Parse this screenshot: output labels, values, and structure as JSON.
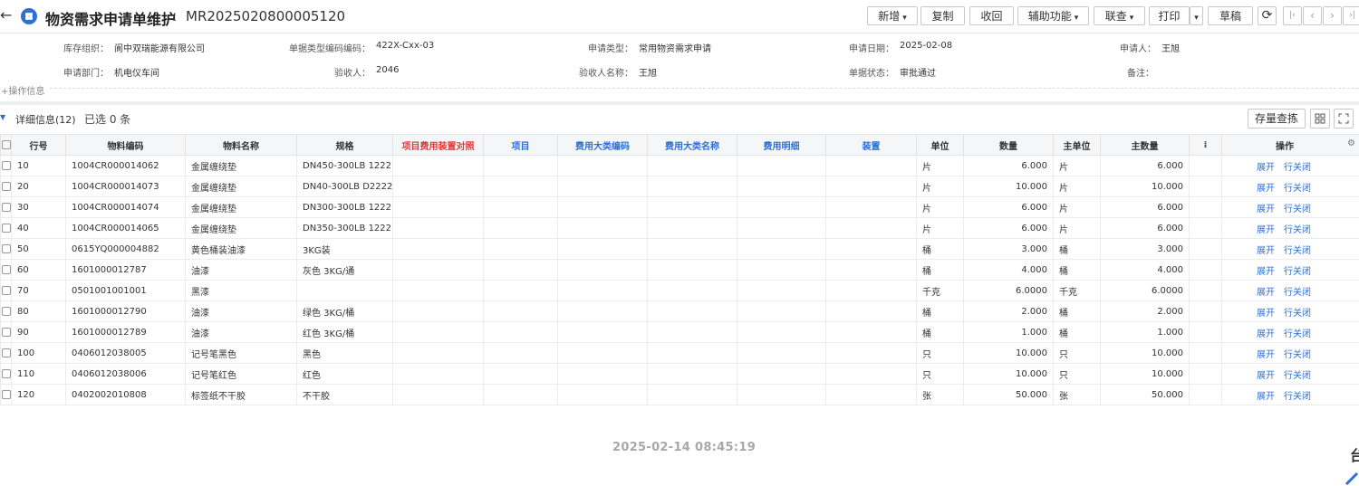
{
  "header": {
    "title": "物资需求申请单维护",
    "separator": ":",
    "code": "MR2025020800005120",
    "buttons": {
      "add": "新增",
      "copy": "复制",
      "recall": "收回",
      "aux": "辅助功能",
      "query": "联查",
      "print": "打印",
      "draft": "草稿"
    },
    "back_glyph": "←",
    "refresh_glyph": "⟳",
    "pager": [
      "|‹",
      "‹",
      "›",
      "›|"
    ]
  },
  "form": {
    "org_label": "库存组织：",
    "org_value": "阆中双瑞能源有限公司",
    "doctype_label": "单据类型编码编码：",
    "doctype_value": "422X-Cxx-03",
    "applytype_label": "申请类型：",
    "applytype_value": "常用物资需求申请",
    "date_label": "申请日期：",
    "date_value": "2025-02-08",
    "applicant_label": "申请人：",
    "applicant_value": "王旭",
    "dept_label": "申请部门：",
    "dept_value": "机电仪车间",
    "checker_label": "验收人：",
    "checker_value": "2046",
    "checkername_label": "验收人名称：",
    "checkername_value": "王旭",
    "status_label": "单据状态：",
    "status_value": "审批通过",
    "remark_label": "备注：",
    "remark_value": ""
  },
  "ops_toggle": "+操作信息",
  "detail": {
    "title": "详细信息(12)",
    "selected": "已选 0 条",
    "stock_button": "存量查拣"
  },
  "table": {
    "headers": [
      "行号",
      "物料编码",
      "物料名称",
      "规格",
      "项目费用装置对照",
      "项目",
      "费用大类编码",
      "费用大类名称",
      "费用明细",
      "装置",
      "单位",
      "数量",
      "主单位",
      "主数量",
      "",
      "操作"
    ],
    "rows": [
      {
        "no": "10",
        "code": "1004CR000014062",
        "name": "金属缠绕垫",
        "spec": "DN450-300LB 1222",
        "unit": "片",
        "qty": "6.000",
        "munit": "片",
        "mqty": "6.000"
      },
      {
        "no": "20",
        "code": "1004CR000014073",
        "name": "金属缠绕垫",
        "spec": "DN40-300LB D2222",
        "unit": "片",
        "qty": "10.000",
        "munit": "片",
        "mqty": "10.000"
      },
      {
        "no": "30",
        "code": "1004CR000014074",
        "name": "金属缠绕垫",
        "spec": "DN300-300LB 1222",
        "unit": "片",
        "qty": "6.000",
        "munit": "片",
        "mqty": "6.000"
      },
      {
        "no": "40",
        "code": "1004CR000014065",
        "name": "金属缠绕垫",
        "spec": "DN350-300LB 1222",
        "unit": "片",
        "qty": "6.000",
        "munit": "片",
        "mqty": "6.000"
      },
      {
        "no": "50",
        "code": "0615YQ000004882",
        "name": "黄色桶装油漆",
        "spec": "3KG装",
        "unit": "桶",
        "qty": "3.000",
        "munit": "桶",
        "mqty": "3.000"
      },
      {
        "no": "60",
        "code": "1601000012787",
        "name": "油漆",
        "spec": "灰色 3KG/通",
        "unit": "桶",
        "qty": "4.000",
        "munit": "桶",
        "mqty": "4.000"
      },
      {
        "no": "70",
        "code": "0501001001001",
        "name": "黑漆",
        "spec": "",
        "unit": "千克",
        "qty": "6.0000",
        "munit": "千克",
        "mqty": "6.0000"
      },
      {
        "no": "80",
        "code": "1601000012790",
        "name": "油漆",
        "spec": "绿色 3KG/桶",
        "unit": "桶",
        "qty": "2.000",
        "munit": "桶",
        "mqty": "2.000"
      },
      {
        "no": "90",
        "code": "1601000012789",
        "name": "油漆",
        "spec": "红色 3KG/桶",
        "unit": "桶",
        "qty": "1.000",
        "munit": "桶",
        "mqty": "1.000"
      },
      {
        "no": "100",
        "code": "0406012038005",
        "name": "记号笔黑色",
        "spec": "黑色",
        "unit": "只",
        "qty": "10.000",
        "munit": "只",
        "mqty": "10.000"
      },
      {
        "no": "110",
        "code": "0406012038006",
        "name": "记号笔红色",
        "spec": "红色",
        "unit": "只",
        "qty": "10.000",
        "munit": "只",
        "mqty": "10.000"
      },
      {
        "no": "120",
        "code": "0402002010808",
        "name": "标签纸不干胶",
        "spec": "不干胶",
        "unit": "张",
        "qty": "50.000",
        "munit": "张",
        "mqty": "50.000"
      }
    ],
    "op_expand": "展开",
    "op_close": "行关闭"
  },
  "timestamp": "2025-02-14 08:45:19",
  "side_char": "台",
  "colors": {
    "accent": "#2b6fd8",
    "red_header": "#e23a3a"
  }
}
